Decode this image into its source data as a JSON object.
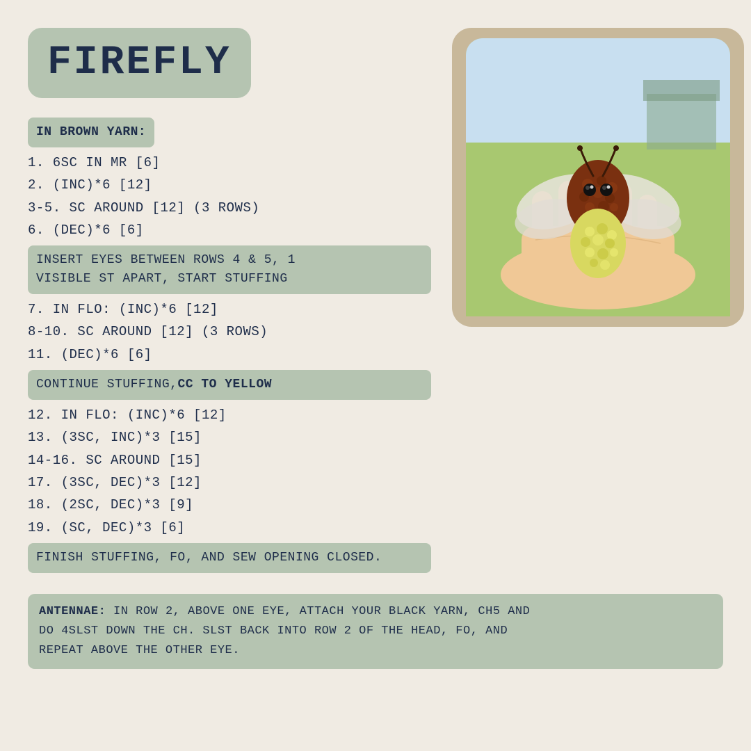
{
  "page": {
    "background_color": "#f0ebe3",
    "title": "FIREFLY"
  },
  "title_box": {
    "label": "FIREFLY"
  },
  "sections": {
    "in_brown_yarn_label": "IN BROWN YARN:",
    "step1": "1.  6SC IN MR [6]",
    "step2": "2.  (INC)*6  [12]",
    "step3": "3-5.  SC AROUND [12] (3 ROWS)",
    "step4": "6.  (DEC)*6  [6]",
    "step5_highlight": "INSERT EYES BETWEEN ROWS 4 & 5, 1\nVISIBLE ST APART, START STUFFING",
    "step6": "7.  IN FLO: (INC)*6 [12]",
    "step7": "8-10. SC AROUND [12] (3 ROWS)",
    "step8": "11.  (DEC)*6  [6]",
    "step9_highlight_pre": "CONTINUE STUFFING,  ",
    "step9_highlight_bold": "CC TO YELLOW",
    "step10": "12.  IN FLO: (INC)*6 [12]",
    "step11": "13.  (3SC, INC)*3 [15]",
    "step12": "14-16. SC AROUND [15]",
    "step13": "17.  (3SC, DEC)*3 [12]",
    "step14": "18.  (2SC, DEC)*3 [9]",
    "step15": "19.  (SC, DEC)*3  [6]",
    "finish_highlight": "FINISH STUFFING, FO, AND SEW OPENING CLOSED.",
    "antennae_label": "ANTENNAE:",
    "antennae_text": " IN ROW 2, ABOVE ONE EYE, ATTACH YOUR BLACK YARN, CH5 AND\nDO 4SLST DOWN THE CH. SLST BACK INTO ROW 2 OF THE HEAD, FO, AND\nREPEAT ABOVE THE OTHER EYE."
  }
}
